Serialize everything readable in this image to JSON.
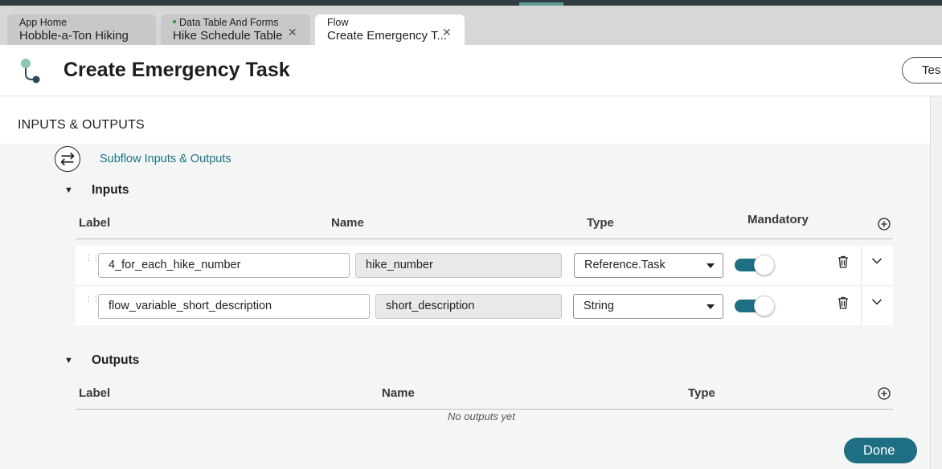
{
  "tabs": [
    {
      "small": "App Home",
      "big": "Hobble-a-Ton Hiking"
    },
    {
      "small": "Data Table And Forms",
      "big": "Hike Schedule Table"
    },
    {
      "small": "Flow",
      "big": "Create Emergency T..."
    }
  ],
  "header": {
    "title": "Create Emergency Task",
    "test_label": "Tes"
  },
  "section_title": "INPUTS & OUTPUTS",
  "subflow_link": "Subflow Inputs & Outputs",
  "inputs": {
    "group_label": "Inputs",
    "columns": {
      "label": "Label",
      "name": "Name",
      "type": "Type",
      "mandatory": "Mandatory"
    },
    "rows": [
      {
        "label": "4_for_each_hike_number",
        "name": "hike_number",
        "type": "Reference.Task",
        "mandatory": true
      },
      {
        "label": "flow_variable_short_description",
        "name": "short_description",
        "type": "String",
        "mandatory": true
      }
    ]
  },
  "outputs": {
    "group_label": "Outputs",
    "columns": {
      "label": "Label",
      "name": "Name",
      "type": "Type"
    },
    "empty_text": "No outputs yet"
  },
  "done_label": "Done",
  "colors": {
    "accent": "#1e6f84",
    "link": "#1a7284"
  }
}
